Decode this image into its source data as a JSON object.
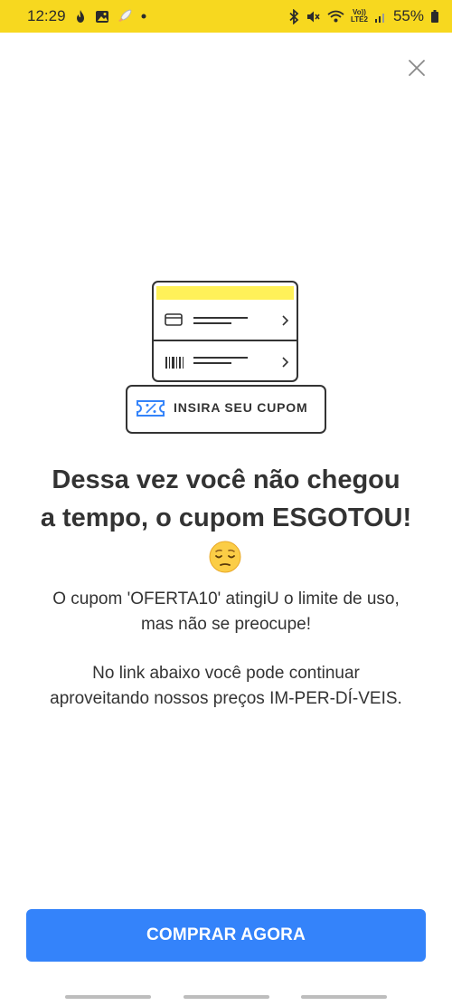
{
  "status_bar": {
    "time": "12:29",
    "left_icons": [
      "fire-icon",
      "gallery-icon",
      "rocket-icon",
      "dot-icon"
    ],
    "right_icons": [
      "bluetooth-icon",
      "mute-icon",
      "wifi-icon",
      "volte-icon",
      "signal-icon",
      "battery-icon"
    ],
    "volte_label_1": "Vo))",
    "volte_label_2": "LTE2",
    "battery": "55%",
    "background": "#f7d81f"
  },
  "dialog": {
    "close_icon": "close-icon",
    "illustration": {
      "coupon_label": "INSIRA SEU CUPOM",
      "header_color": "#fff159",
      "accent_color": "#3483fa"
    },
    "headline_line1": "Dessa vez você não chegou",
    "headline_line2": "a tempo, o cupom ESGOTOU!",
    "emoji_icon": "pensive-face-emoji",
    "message_line1": "O cupom 'OFERTA10' atingiU o limite de uso,",
    "message_line2": "mas não se preocupe!",
    "message_line3": "No link abaixo você pode continuar",
    "message_line4": "aproveitando nossos preços IM-PER-DÍ-VEIS.",
    "button_label": "COMPRAR AGORA",
    "button_color": "#3483fa"
  },
  "nav_bar": {
    "pill_color": "#bdbdbd"
  }
}
